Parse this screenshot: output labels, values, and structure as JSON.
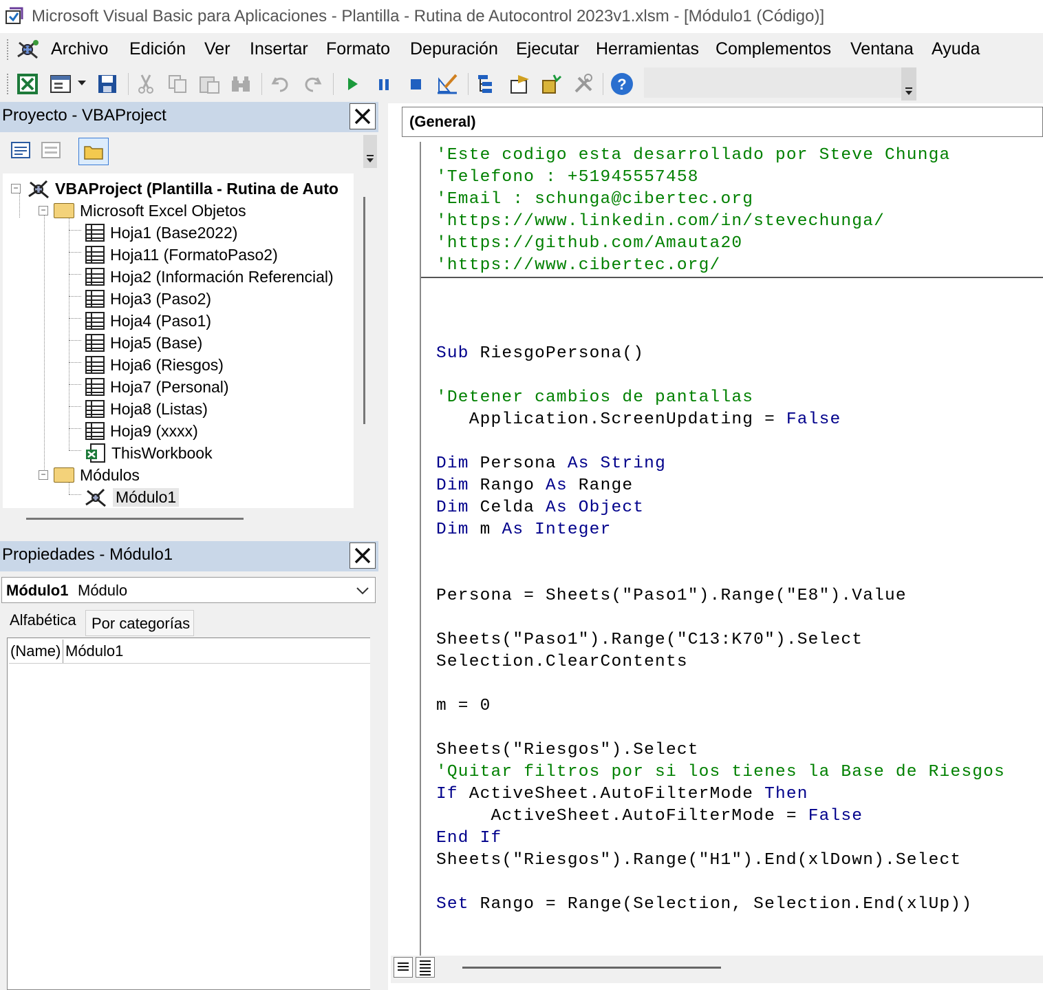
{
  "window": {
    "title": "Microsoft Visual Basic para Aplicaciones - Plantilla - Rutina de Autocontrol 2023v1.xlsm - [Módulo1 (Código)]"
  },
  "menu": {
    "items": [
      "Archivo",
      "Edición",
      "Ver",
      "Insertar",
      "Formato",
      "Depuración",
      "Ejecutar",
      "Herramientas",
      "Complementos",
      "Ventana",
      "Ayuda"
    ]
  },
  "toolbar": {
    "icons": [
      "excel-icon",
      "insert-userform-icon",
      "save-icon",
      "cut-icon",
      "copy-icon",
      "paste-icon",
      "find-icon",
      "undo-icon",
      "redo-icon",
      "run-icon",
      "break-icon",
      "reset-icon",
      "design-mode-icon",
      "project-explorer-icon",
      "properties-icon",
      "object-browser-icon",
      "toolbox-icon",
      "help-icon"
    ]
  },
  "project": {
    "title": "Proyecto - VBAProject",
    "root": "VBAProject (Plantilla - Rutina de Auto",
    "excel_folder": "Microsoft Excel Objetos",
    "sheets": [
      "Hoja1 (Base2022)",
      "Hoja11 (FormatoPaso2)",
      "Hoja2 (Información Referencial)",
      "Hoja3 (Paso2)",
      "Hoja4 (Paso1)",
      "Hoja5 (Base)",
      "Hoja6 (Riesgos)",
      "Hoja7 (Personal)",
      "Hoja8 (Listas)",
      "Hoja9 (xxxx)"
    ],
    "workbook": "ThisWorkbook",
    "modules_folder": "Módulos",
    "module": "Módulo1"
  },
  "properties": {
    "title": "Propiedades - Módulo1",
    "object_name": "Módulo1",
    "object_type": "Módulo",
    "tab_alpha": "Alfabética",
    "tab_categories": "Por categorías",
    "row_name": "(Name)",
    "row_value": "Módulo1"
  },
  "code": {
    "object_combo": "(General)",
    "header_lines": [
      "'Este codigo esta desarrollado por Steve Chunga",
      "'Telefono : +51945557458",
      "'Email : schunga@cibertec.org",
      "'https://www.linkedin.com/in/stevechunga/",
      "'https://github.com/Amauta20",
      "'https://www.cibertec.org/"
    ],
    "lines": {
      "sub_kw": "Sub",
      "sub_rest": " RiesgoPersona()",
      "c1": "'Detener cambios de pantallas",
      "su_a": "   Application.ScreenUpdating = ",
      "false_kw": "False",
      "dim": "Dim",
      "as": "As",
      "d1_name": " Persona ",
      "d1_type": " String",
      "d2_name": " Rango ",
      "d2_type": " Range",
      "d3_name": " Celda ",
      "d3_type": " Object",
      "d4_name": " m ",
      "d4_type": " Integer",
      "persona": "Persona = Sheets(\"Paso1\").Range(\"E8\").Value",
      "sel1": "Sheets(\"Paso1\").Range(\"C13:K70\").Select",
      "clear": "Selection.ClearContents",
      "m0": "m = 0",
      "sel2": "Sheets(\"Riesgos\").Select",
      "c2": "'Quitar filtros por si los tienes la Base de Riesgos",
      "if_kw": "If",
      "if_rest": " ActiveSheet.AutoFilterMode ",
      "then_kw": "Then",
      "af": "     ActiveSheet.AutoFilterMode = ",
      "endif": "End If",
      "sel3": "Sheets(\"Riesgos\").Range(\"H1\").End(xlDown).Select",
      "set_kw": "Set",
      "set_rest": " Rango = Range(Selection, Selection.End(xlUp))"
    }
  }
}
